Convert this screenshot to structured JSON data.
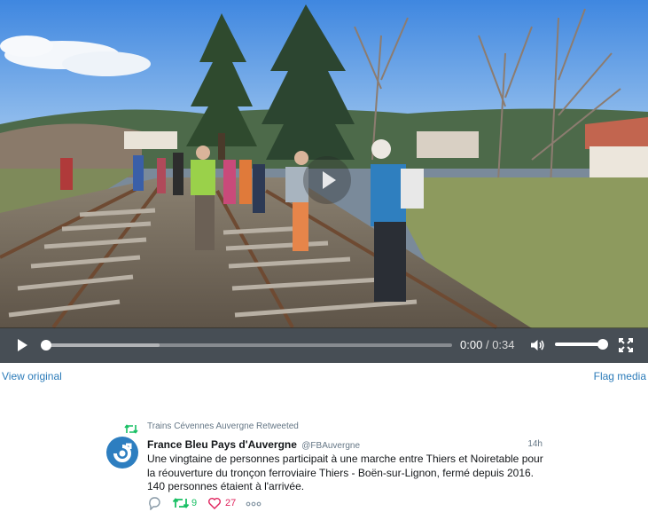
{
  "video": {
    "current_time": "0:00",
    "separator": "/",
    "duration": "0:34",
    "progress_fraction": 0.0,
    "volume_fraction": 1.0,
    "icons": {
      "center_play": "play-icon",
      "play": "play-icon",
      "volume": "volume-icon",
      "fullscreen": "fullscreen-icon"
    }
  },
  "media_links": {
    "view_original": "View original",
    "flag_media": "Flag media"
  },
  "tweet": {
    "retweet_context": "Trains Cévennes Auvergne Retweeted",
    "author_name": "France Bleu Pays d'Auvergne",
    "author_handle": "@FBAuvergne",
    "time_ago": "14h",
    "text": "Une vingtaine de personnes participait à une marche entre Thiers et Noiretable pour la réouverture du tronçon ferroviaire Thiers - Boën-sur-Lignon, fermé depuis 2016. 140 personnes étaient à l'arrivée.",
    "actions": {
      "retweet_count": "9",
      "like_count": "27"
    },
    "colors": {
      "link": "#2b7bb9",
      "retweet_green": "#17bf63",
      "like_red": "#e0245e",
      "muted": "#657786",
      "avatar_blue": "#2d7ec0"
    }
  }
}
